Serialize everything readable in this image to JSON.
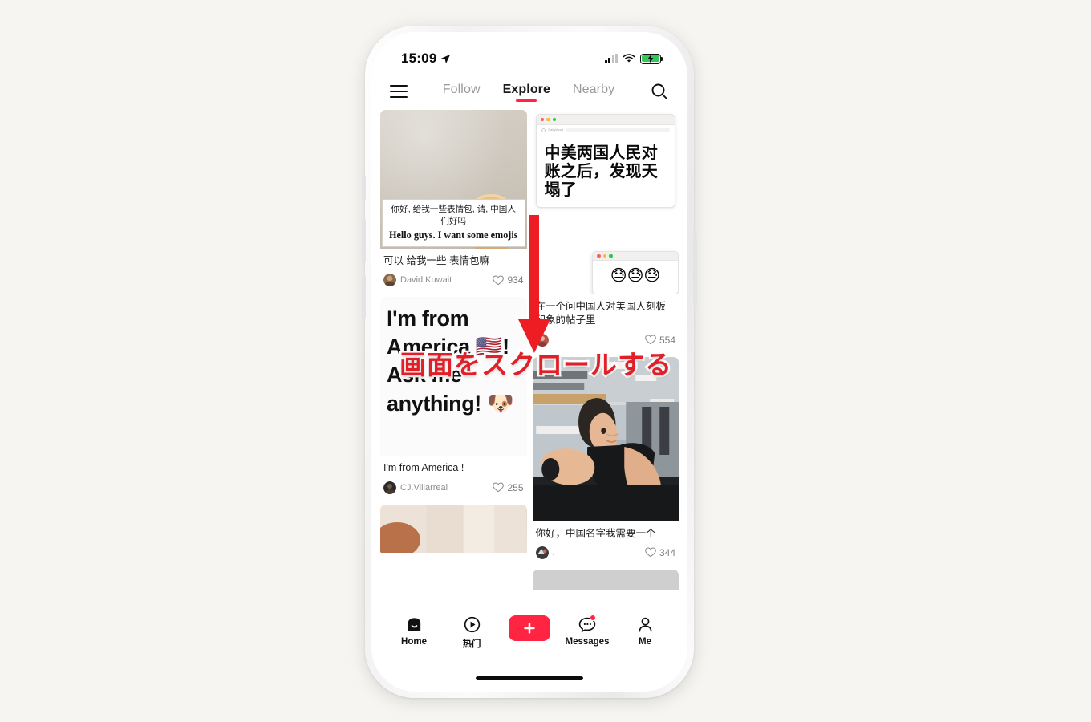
{
  "status_bar": {
    "time": "15:09",
    "location_icon": "location-arrow-icon",
    "signal_icon": "cellular-signal-icon",
    "wifi_icon": "wifi-icon",
    "battery_icon": "battery-charging-icon"
  },
  "top_nav": {
    "menu_icon": "hamburger-menu-icon",
    "search_icon": "search-icon",
    "tabs": [
      {
        "label": "Follow",
        "active": false
      },
      {
        "label": "Explore",
        "active": true
      },
      {
        "label": "Nearby",
        "active": false
      }
    ]
  },
  "feed": {
    "posts": [
      {
        "id": "post-dog-emoji",
        "column": "left",
        "image_alt": "golden-retriever-dog-photo",
        "overlay_cn": "你好, 给我一些表情包, 请, 中国人们好吗",
        "overlay_en": "Hello guys. I want some emojis",
        "title": "可以 给我一些 表情包嘛",
        "author": "David Kuwait",
        "likes": "934",
        "like_icon": "heart-outline-icon"
      },
      {
        "id": "post-browser-mock",
        "column": "right",
        "window_title": "DailyMood",
        "headline": "中美两国人民对账之后，发现天塌了",
        "emoji": "😓😓😓",
        "title": "在一个问中国人对美国人刻板印象的帖子里",
        "author": "",
        "likes": "554",
        "like_icon": "heart-outline-icon"
      },
      {
        "id": "post-im-from-america",
        "column": "left",
        "poster_lines": [
          "I'm from",
          "America 🇺🇸!",
          "Ask me",
          "anything! 🐶"
        ],
        "title": "I'm from America !",
        "author": "CJ.Villarreal",
        "likes": "255",
        "like_icon": "heart-outline-icon"
      },
      {
        "id": "post-gym-chinese-name",
        "column": "right",
        "image_alt": "man-in-gym-photo",
        "title": "你好，中国名字我需要一个",
        "author": ".",
        "likes": "344",
        "like_icon": "heart-outline-icon"
      }
    ]
  },
  "tab_bar": {
    "items": [
      {
        "label": "Home",
        "icon": "home-icon",
        "active": true,
        "badge": false
      },
      {
        "label": "热门",
        "icon": "play-circle-icon",
        "active": false,
        "badge": false
      },
      {
        "label": "",
        "icon": "plus-icon",
        "active": false,
        "badge": false
      },
      {
        "label": "Messages",
        "icon": "chat-bubble-icon",
        "active": false,
        "badge": true
      },
      {
        "label": "Me",
        "icon": "person-icon",
        "active": false,
        "badge": false
      }
    ]
  },
  "annotation": {
    "text": "画面をスクロールする",
    "arrow_icon": "red-down-arrow-icon",
    "color": "#e01f28"
  },
  "colors": {
    "accent": "#ff2442",
    "annotation_red": "#e01f28",
    "page_background": "#f7f5f1",
    "battery_green": "#34c759"
  }
}
